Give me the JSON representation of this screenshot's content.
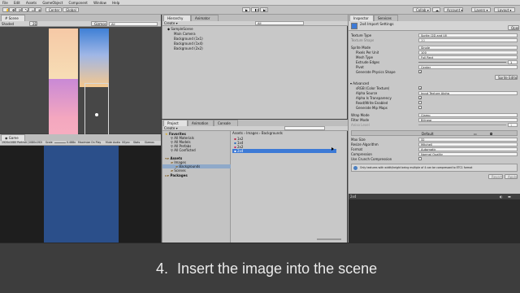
{
  "menubar": {
    "items": [
      "File",
      "Edit",
      "Assets",
      "GameObject",
      "Component",
      "Window",
      "Help"
    ]
  },
  "toolbar": {
    "pivot": "Center",
    "space": "Global",
    "play": "▶",
    "pause": "❚❚",
    "step": "▶|",
    "collab": "Collab ▾",
    "account": "Account ▾",
    "layers": "Layers ▾",
    "layout": "Layout ▾"
  },
  "scene": {
    "tab": "Scene",
    "shading": "Shaded",
    "mode_2d": "2D",
    "gizmos": "Gizmos ▾",
    "search_placeholder": "All"
  },
  "hierarchy": {
    "tab": "Hierarchy",
    "tab2": "Animator",
    "create": "Create ▾",
    "search_placeholder": "All",
    "scene_name": "SampleScene",
    "items": [
      "Main Camera",
      "Background (1x1)",
      "Background (1x4)",
      "Background (2x2)"
    ]
  },
  "project": {
    "tabs": [
      "Project",
      "Animation",
      "Console"
    ],
    "create": "Create ▾",
    "tree": {
      "favorites": "Favorites",
      "fav_items": [
        "All Materials",
        "All Models",
        "All Prefabs",
        "All Conflicted"
      ],
      "assets": "Assets",
      "asset_items": [
        "Images",
        "Backgrounds",
        "Scenes"
      ],
      "packages": "Packages"
    },
    "breadcrumb": "Assets › Images › Backgrounds",
    "files": [
      "1x2",
      "1x4",
      "2x2",
      "2x4"
    ],
    "selected_file": "2x4"
  },
  "game": {
    "tab": "Game",
    "display": "Display 1",
    "resolution": "1920x1080 Portrait (1080x1920)",
    "scale_label": "Scale",
    "scale_value": "0.488x",
    "maximize": "Maximize On Play",
    "mute": "Mute Audio",
    "vsync": "VSync",
    "stats": "Stats",
    "gizmos": "Gizmos"
  },
  "inspector": {
    "tab": "Inspector",
    "tab2": "Services",
    "title": "2x4 Import Settings",
    "open_btn": "Open",
    "rows": [
      {
        "label": "Texture Type",
        "value": "Sprite (2D and UI)"
      },
      {
        "label": "Texture Shape",
        "value": "2D"
      },
      {
        "label": "Sprite Mode",
        "value": "Single"
      },
      {
        "label": "Pixels Per Unit",
        "value": "100"
      },
      {
        "label": "Mesh Type",
        "value": "Full Rect"
      },
      {
        "label": "Extrude Edges",
        "value": "1"
      },
      {
        "label": "Pivot",
        "value": "Center"
      }
    ],
    "gen_physics": "Generate Physics Shape",
    "sprite_editor": "Sprite Editor",
    "advanced": "Advanced",
    "adv_rows": [
      "sRGB (Color Texture)",
      "Alpha Source",
      "Alpha Is Transparency",
      "Read/Write Enabled",
      "Generate Mip Maps"
    ],
    "alpha_source_value": "Input Texture Alpha",
    "wrap_mode": {
      "label": "Wrap Mode",
      "value": "Clamp"
    },
    "filter_mode": {
      "label": "Filter Mode",
      "value": "Bilinear"
    },
    "aniso": {
      "label": "Aniso Level",
      "value": "1"
    },
    "platform_default": "Default",
    "platform_rows": [
      {
        "label": "Max Size",
        "value": "32"
      },
      {
        "label": "Resize Algorithm",
        "value": "Mitchell"
      },
      {
        "label": "Format",
        "value": "Automatic"
      },
      {
        "label": "Compression",
        "value": "Normal Quality"
      },
      {
        "label": "Use Crunch Compression",
        "value": ""
      }
    ],
    "warning": "Only textures with width/height being multiple of 4 can be compressed to ETC1 format",
    "revert": "Revert",
    "apply": "Apply",
    "preview_label": "2x4"
  },
  "caption": {
    "number": "4.",
    "text": "Insert the image into the scene"
  },
  "colors": {
    "accent": "#3d7ad6",
    "editor_bg": "#c8c8c8",
    "caption_bg": "#3d3d3d",
    "scene_bg": "#474747",
    "game_blue": "#2b4f8a"
  }
}
